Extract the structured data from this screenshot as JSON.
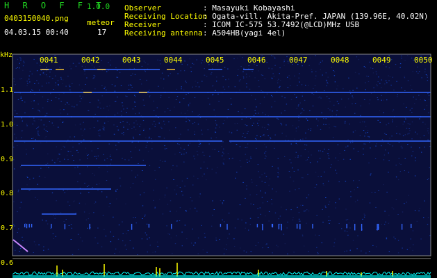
{
  "header": {
    "app_name": "H R O F F T",
    "version": "1.0.0",
    "filename": "0403150040.png",
    "datetime": "04.03.15 00:40",
    "meteor_label": "meteor",
    "meteor_count": "17",
    "info_labels": [
      "Observer",
      "Receiving Location",
      "Receiver",
      "Receiving antenna"
    ],
    "info_values": [
      ": Masayuki Kobayashi",
      ": Ogata-vill. Akita-Pref. JAPAN (139.96E, 40.02N)",
      ": ICOM IC-575 53.7492(@LCD)MHz USB",
      ": A504HB(yagi 4el)"
    ]
  },
  "plot": {
    "y_unit": "kHz",
    "y_ticks": [
      "1.1",
      "1.0",
      "0.9",
      "0.8",
      "0.7",
      "0.6"
    ],
    "x_ticks": [
      "0041",
      "0042",
      "0043",
      "0044",
      "0045",
      "0046",
      "0047",
      "0048",
      "0049",
      "0050"
    ]
  },
  "colors": {
    "background": "#000000",
    "text": "#ffff00",
    "title": "#22dd22",
    "noise": "#1a2a9a",
    "echo": "#3366ff",
    "hot": "#ffcc33",
    "baseline": "#00ffff"
  }
}
